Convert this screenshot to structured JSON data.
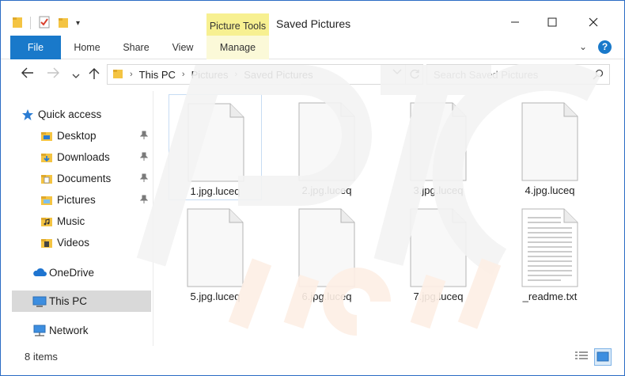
{
  "window": {
    "title": "Saved Pictures",
    "contextual_tab": "Picture Tools",
    "controls": {
      "minimize": "—",
      "maximize": "☐",
      "close": "✕"
    }
  },
  "ribbon": {
    "tabs": [
      {
        "label": "File"
      },
      {
        "label": "Home"
      },
      {
        "label": "Share"
      },
      {
        "label": "View"
      },
      {
        "label": "Manage"
      }
    ],
    "collapse_glyph": "⌄",
    "help_glyph": "?"
  },
  "address": {
    "crumbs": [
      "This PC",
      "Pictures",
      "Saved Pictures"
    ],
    "search_placeholder": "Search Saved Pictures"
  },
  "sidebar": {
    "quick_access": "Quick access",
    "items": [
      {
        "label": "Desktop",
        "icon": "desktop-folder-icon",
        "pinned": true
      },
      {
        "label": "Downloads",
        "icon": "downloads-folder-icon",
        "pinned": true
      },
      {
        "label": "Documents",
        "icon": "documents-folder-icon",
        "pinned": true
      },
      {
        "label": "Pictures",
        "icon": "pictures-folder-icon",
        "pinned": true
      },
      {
        "label": "Music",
        "icon": "music-folder-icon",
        "pinned": false
      },
      {
        "label": "Videos",
        "icon": "videos-folder-icon",
        "pinned": false
      }
    ],
    "onedrive": "OneDrive",
    "thispc": "This PC",
    "network": "Network"
  },
  "files": [
    {
      "name": "1.jpg.luceq",
      "type": "blank",
      "selected": true
    },
    {
      "name": "2.jpg.luceq",
      "type": "blank",
      "selected": false
    },
    {
      "name": "3.jpg.luceq",
      "type": "blank",
      "selected": false
    },
    {
      "name": "4.jpg.luceq",
      "type": "blank",
      "selected": false
    },
    {
      "name": "5.jpg.luceq",
      "type": "blank",
      "selected": false
    },
    {
      "name": "6.jpg.luceq",
      "type": "blank",
      "selected": false
    },
    {
      "name": "7.jpg.luceq",
      "type": "blank",
      "selected": false
    },
    {
      "name": "_readme.txt",
      "type": "text",
      "selected": false
    }
  ],
  "status": {
    "item_count": "8 items"
  },
  "colors": {
    "accent": "#1979ca",
    "contextual": "#f7f091",
    "selection": "#d9d9d9",
    "watermark": "#f3f3f3"
  }
}
